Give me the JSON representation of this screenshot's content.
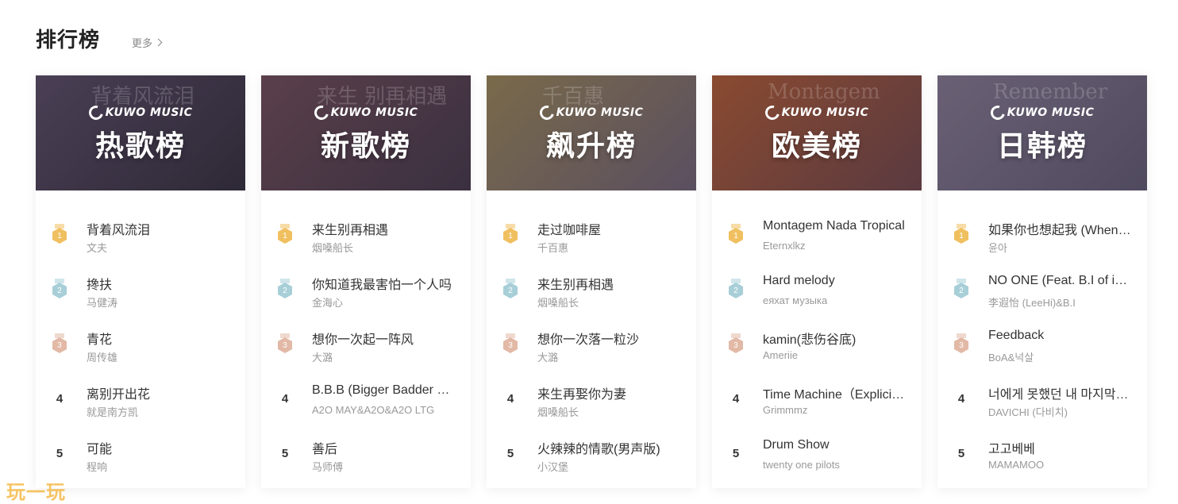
{
  "header": {
    "title": "排行榜",
    "more_label": "更多"
  },
  "brand": {
    "name": "KUWO MUSIC"
  },
  "watermark": "玩一玩",
  "medal_colors": {
    "1": "#f0c060",
    "2": "#a8cfd8",
    "3": "#e2b9a6"
  },
  "boards": [
    {
      "name": "热歌榜",
      "cover_deco": "背着风流泪",
      "cover_colors": [
        "#4a3f55",
        "#2e2936"
      ],
      "songs": [
        {
          "rank": "1",
          "title": "背着风流泪",
          "artist": "文夫"
        },
        {
          "rank": "2",
          "title": "搀扶",
          "artist": "马健涛"
        },
        {
          "rank": "3",
          "title": "青花",
          "artist": "周传雄"
        },
        {
          "rank": "4",
          "title": "离别开出花",
          "artist": "就是南方凯"
        },
        {
          "rank": "5",
          "title": "可能",
          "artist": "程响"
        }
      ]
    },
    {
      "name": "新歌榜",
      "cover_deco": "来生 别再相遇",
      "cover_colors": [
        "#5a3f4a",
        "#3a3040"
      ],
      "songs": [
        {
          "rank": "1",
          "title": "来生别再相遇",
          "artist": "烟嗓船长"
        },
        {
          "rank": "2",
          "title": "你知道我最害怕一个人吗",
          "artist": "金海心"
        },
        {
          "rank": "3",
          "title": "想你一次起一阵风",
          "artist": "大潞"
        },
        {
          "rank": "4",
          "title": "B.B.B (Bigger Badder Better)",
          "artist": "A2O MAY&A2O&A2O LTG"
        },
        {
          "rank": "5",
          "title": "善后",
          "artist": "马师傅"
        }
      ]
    },
    {
      "name": "飙升榜",
      "cover_deco": "千百惠",
      "cover_colors": [
        "#7a6a4a",
        "#5a4f60"
      ],
      "songs": [
        {
          "rank": "1",
          "title": "走过咖啡屋",
          "artist": "千百惠"
        },
        {
          "rank": "2",
          "title": "来生别再相遇",
          "artist": "烟嗓船长"
        },
        {
          "rank": "3",
          "title": "想你一次落一粒沙",
          "artist": "大潞"
        },
        {
          "rank": "4",
          "title": "来生再娶你为妻",
          "artist": "烟嗓船长"
        },
        {
          "rank": "5",
          "title": "火辣辣的情歌(男声版)",
          "artist": "小汉堡"
        }
      ]
    },
    {
      "name": "欧美榜",
      "cover_deco": "Montagem",
      "cover_colors": [
        "#8a4a30",
        "#5a3a40"
      ],
      "songs": [
        {
          "rank": "1",
          "title": "Montagem Nada Tropical",
          "artist": "Eternxlkz"
        },
        {
          "rank": "2",
          "title": "Hard melody",
          "artist": "еяхат музыка"
        },
        {
          "rank": "3",
          "title": "kamin(悲伤谷底)",
          "artist": "Ameriie"
        },
        {
          "rank": "4",
          "title": "Time Machine（Explicit）",
          "artist": "Grimmmz"
        },
        {
          "rank": "5",
          "title": "Drum Show",
          "artist": "twenty one pilots"
        }
      ]
    },
    {
      "name": "日韩榜",
      "cover_deco": "Remember",
      "cover_colors": [
        "#6a6075",
        "#504a5e"
      ],
      "songs": [
        {
          "rank": "1",
          "title": "如果你也想起我 (When You Think of Me)",
          "artist": "윤아"
        },
        {
          "rank": "2",
          "title": "NO ONE (Feat. B.I of iKON)",
          "artist": "李遐怡 (LeeHi)&B.I"
        },
        {
          "rank": "3",
          "title": "Feedback",
          "artist": "BoA&넉살"
        },
        {
          "rank": "4",
          "title": "너에게 못했던 내 마지막 말은",
          "artist": "DAVICHI (다비치)"
        },
        {
          "rank": "5",
          "title": "고고베베",
          "artist": "MAMAMOO"
        }
      ]
    }
  ]
}
